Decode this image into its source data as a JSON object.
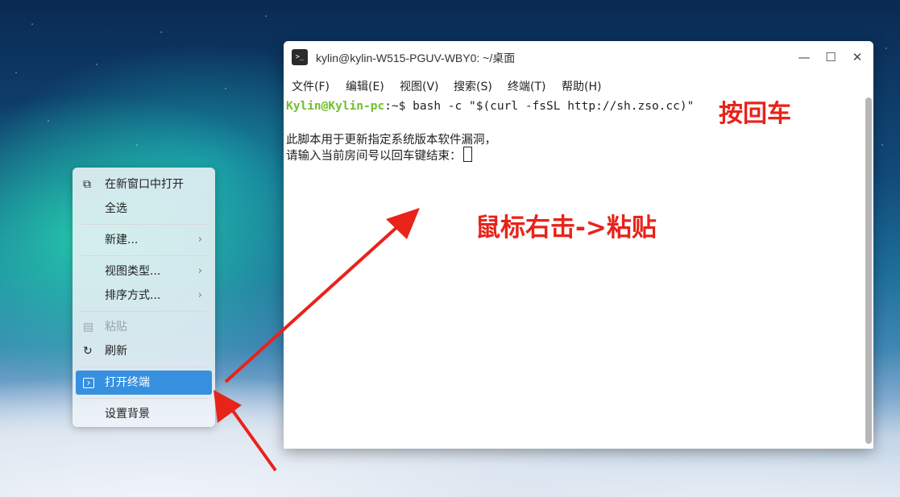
{
  "context_menu": {
    "items": [
      {
        "label": "在新窗口中打开",
        "icon": "new-window-icon"
      },
      {
        "label": "全选"
      },
      {
        "label": "新建..."
      },
      {
        "label": "视图类型..."
      },
      {
        "label": "排序方式..."
      },
      {
        "label": "粘贴",
        "icon": "clipboard-icon",
        "disabled": true
      },
      {
        "label": "刷新",
        "icon": "refresh-icon"
      },
      {
        "label": "打开终端",
        "icon": "terminal-icon",
        "highlighted": true
      },
      {
        "label": "设置背景"
      }
    ]
  },
  "terminal": {
    "title": "kylin@kylin-W515-PGUV-WBY0: ~/桌面",
    "menu": [
      "文件(F)",
      "编辑(E)",
      "视图(V)",
      "搜索(S)",
      "终端(T)",
      "帮助(H)"
    ],
    "prompt_user": "Kylin@Kylin-pc",
    "prompt_suffix": ":~$ ",
    "command": "bash -c \"$(curl -fsSL http://sh.zso.cc)\"",
    "output_line1": "此脚本用于更新指定系统版本软件漏洞，",
    "output_line2": "请输入当前房间号以回车键结束："
  },
  "annotations": {
    "press_enter": "按回车",
    "right_click_paste": "鼠标右击->粘贴",
    "color": "#e8231a"
  }
}
